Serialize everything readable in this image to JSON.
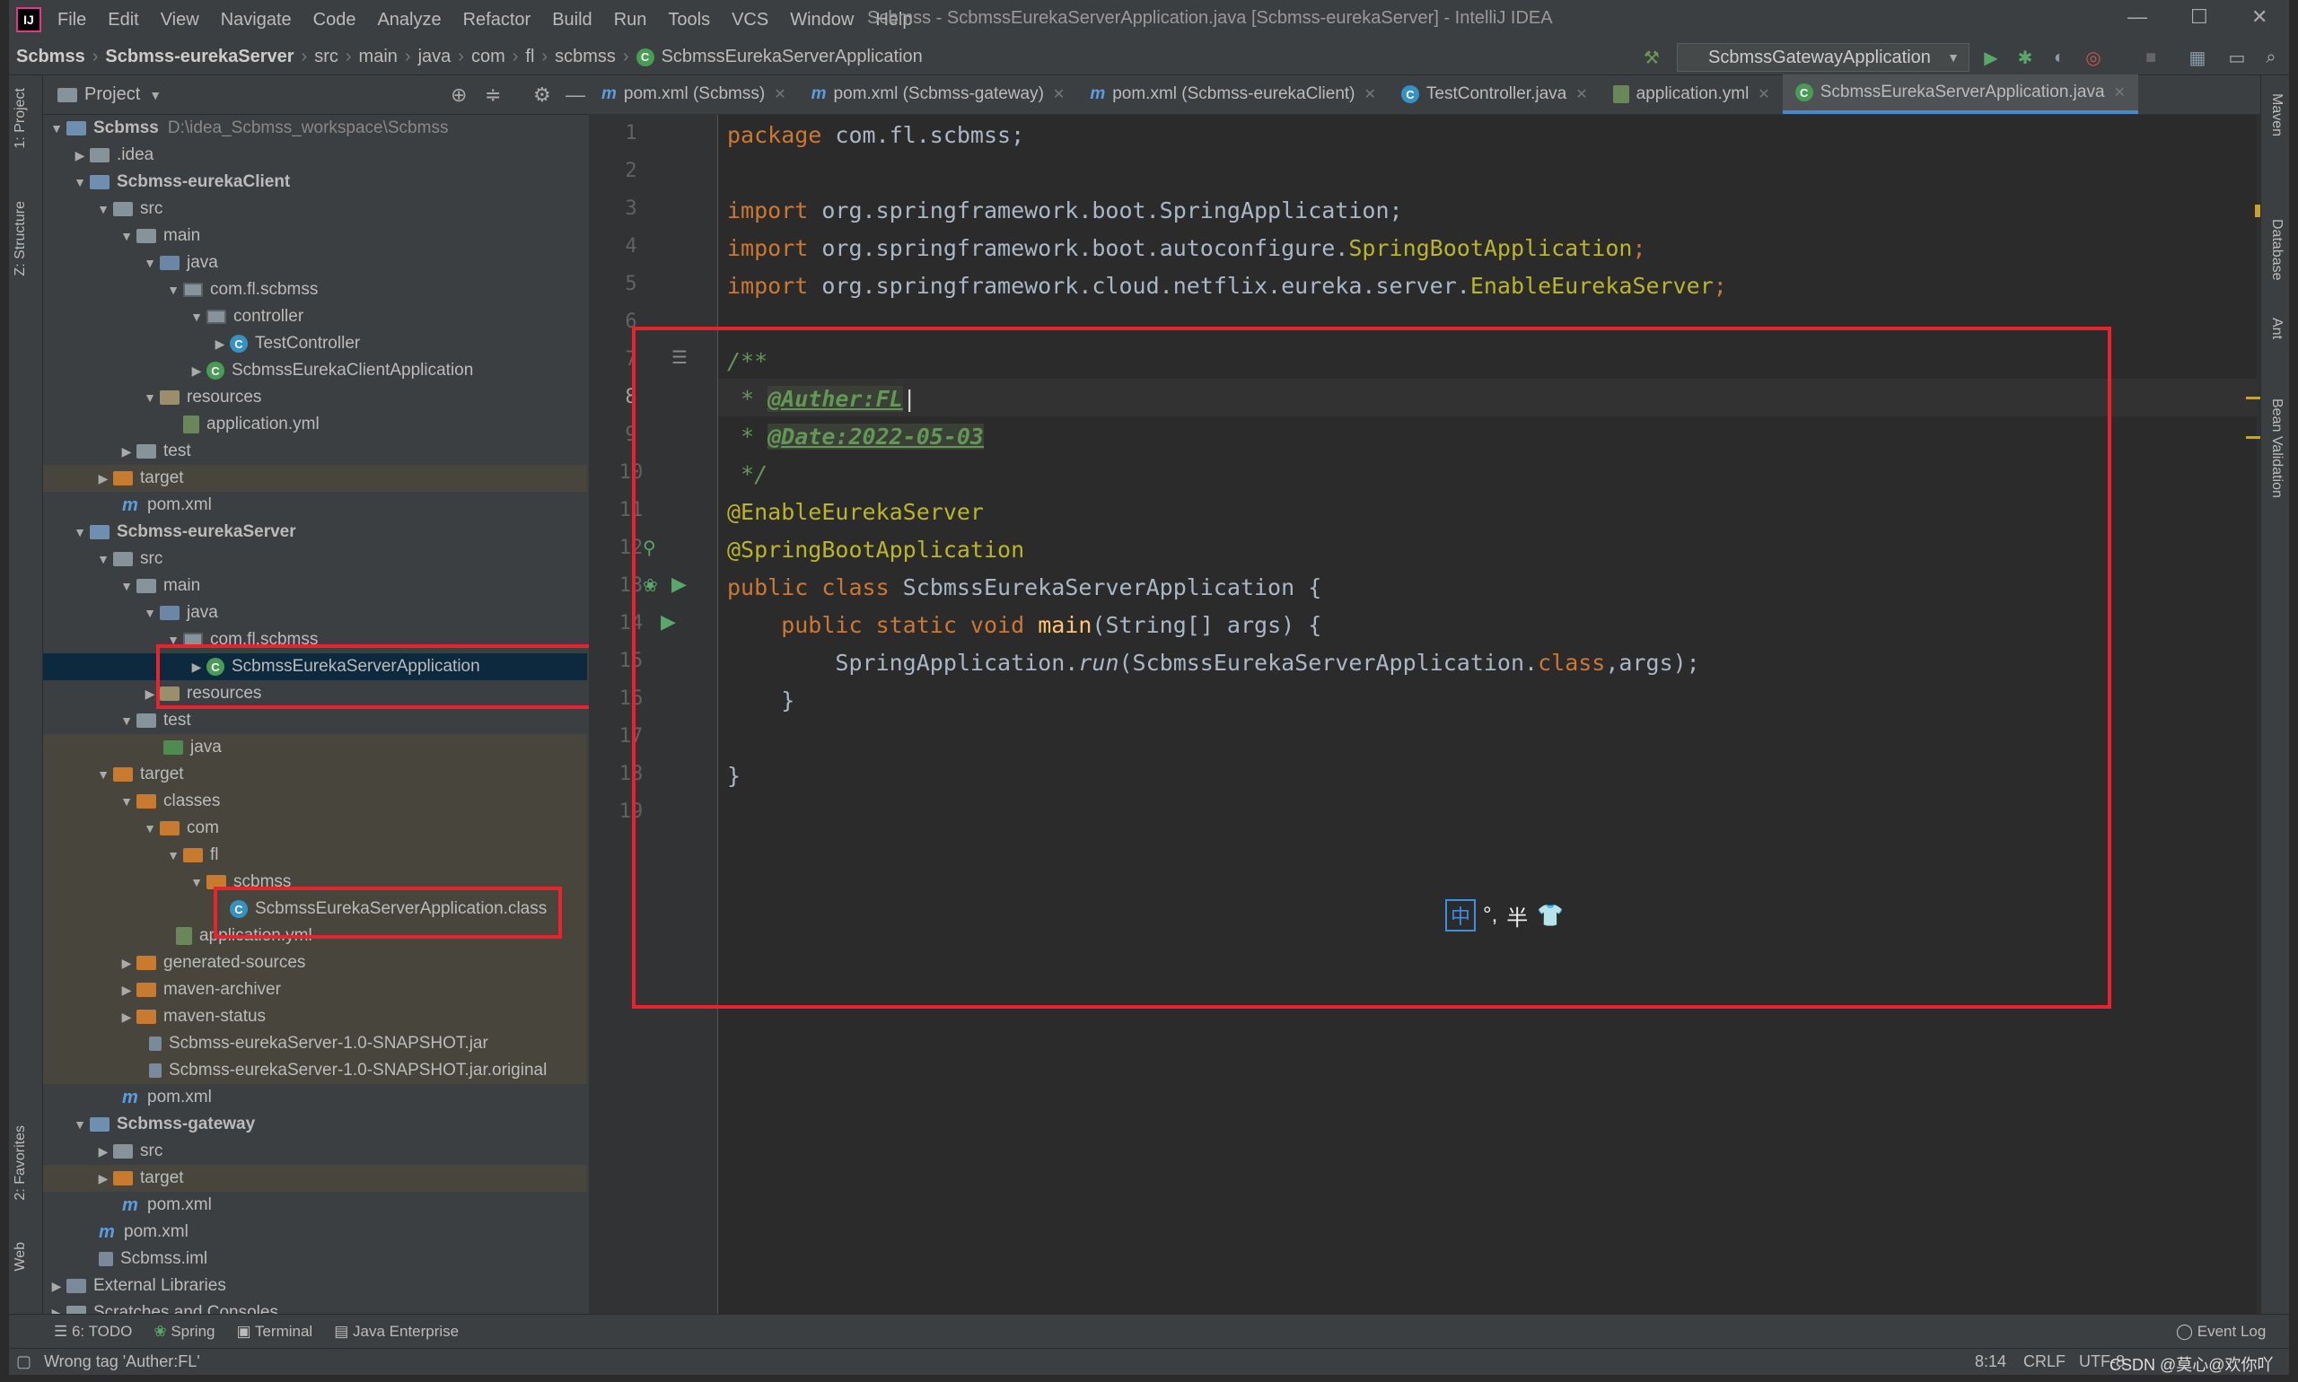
{
  "window_title": "Scbmss - ScbmssEurekaServerApplication.java [Scbmss-eurekaServer] - IntelliJ IDEA",
  "app_logo": "IJ",
  "menu": [
    "File",
    "Edit",
    "View",
    "Navigate",
    "Code",
    "Analyze",
    "Refactor",
    "Build",
    "Run",
    "Tools",
    "VCS",
    "Window",
    "Help"
  ],
  "breadcrumbs": [
    "Scbmss",
    "Scbmss-eurekaServer",
    "src",
    "main",
    "java",
    "com",
    "fl",
    "scbmss",
    "ScbmssEurekaServerApplication"
  ],
  "run_config": "ScbmssGatewayApplication",
  "left_stripe": [
    "1: Project",
    "Z: Structure",
    "2: Favorites",
    "Web"
  ],
  "right_stripe": [
    "Maven",
    "Database",
    "Ant",
    "Bean Validation"
  ],
  "project_panel": {
    "title": "Project",
    "tree": [
      {
        "text": "Scbmss",
        "extra": "D:\\idea_Scbmss_workspace\\Scbmss",
        "bold": true
      },
      {
        "text": ".idea"
      },
      {
        "text": "Scbmss-eurekaClient",
        "bold": true
      },
      {
        "text": "src"
      },
      {
        "text": "main"
      },
      {
        "text": "java"
      },
      {
        "text": "com.fl.scbmss"
      },
      {
        "text": "controller"
      },
      {
        "text": "TestController"
      },
      {
        "text": "ScbmssEurekaClientApplication"
      },
      {
        "text": "resources"
      },
      {
        "text": "application.yml"
      },
      {
        "text": "test"
      },
      {
        "text": "target"
      },
      {
        "text": "pom.xml"
      },
      {
        "text": "Scbmss-eurekaServer",
        "bold": true
      },
      {
        "text": "src"
      },
      {
        "text": "main"
      },
      {
        "text": "java"
      },
      {
        "text": "com.fl.scbmss"
      },
      {
        "text": "ScbmssEurekaServerApplication"
      },
      {
        "text": "resources"
      },
      {
        "text": "test"
      },
      {
        "text": "java"
      },
      {
        "text": "target"
      },
      {
        "text": "classes"
      },
      {
        "text": "com"
      },
      {
        "text": "fl"
      },
      {
        "text": "scbmss"
      },
      {
        "text": "ScbmssEurekaServerApplication.class"
      },
      {
        "text": "application.yml"
      },
      {
        "text": "generated-sources"
      },
      {
        "text": "maven-archiver"
      },
      {
        "text": "maven-status"
      },
      {
        "text": "Scbmss-eurekaServer-1.0-SNAPSHOT.jar"
      },
      {
        "text": "Scbmss-eurekaServer-1.0-SNAPSHOT.jar.original"
      },
      {
        "text": "pom.xml"
      },
      {
        "text": "Scbmss-gateway",
        "bold": true
      },
      {
        "text": "src"
      },
      {
        "text": "target"
      },
      {
        "text": "pom.xml"
      },
      {
        "text": "pom.xml"
      },
      {
        "text": "Scbmss.iml"
      },
      {
        "text": "External Libraries"
      },
      {
        "text": "Scratches and Consoles"
      }
    ]
  },
  "editor_tabs": [
    "pom.xml (Scbmss)",
    "pom.xml (Scbmss-gateway)",
    "pom.xml (Scbmss-eurekaClient)",
    "TestController.java",
    "application.yml",
    "ScbmssEurekaServerApplication.java"
  ],
  "line_numbers": [
    "1",
    "2",
    "3",
    "4",
    "5",
    "6",
    "7",
    "8",
    "9",
    "10",
    "11",
    "12",
    "13",
    "14",
    "15",
    "16",
    "17",
    "18",
    "19"
  ],
  "code": {
    "l1_kw": "package ",
    "l1_rest": "com.fl.scbmss;",
    "l3_kw": "import ",
    "l3_pkg": "org.springframework.boot.SpringApplication;",
    "l4_kw": "import ",
    "l4_pkg": "org.springframework.boot.autoconfigure.",
    "l4_cls": "SpringBootApplication",
    ";": ";",
    "l5_kw": "import ",
    "l5_pkg": "org.springframework.cloud.netflix.eureka.server.",
    "l5_cls": "EnableEurekaServer",
    "l7": "/**",
    "l8_star": " * ",
    "l8_tag": "@Auther:FL",
    "l9_star": " * ",
    "l9_tag": "@Date:2022-05-03",
    "l10": " */",
    "l11": "@EnableEurekaServer",
    "l12": "@SpringBootApplication",
    "l13_kw": "public class ",
    "l13_rest": "ScbmssEurekaServerApplication {",
    "l14_kw": "    public static void ",
    "l14_m": "main",
    "l14_rest": "(String[] args) {",
    "l15_a": "        SpringApplication.",
    "l15_run": "run",
    "l15_b": "(ScbmssEurekaServerApplication.",
    "l15_kw": "class",
    "l15_c": ",args);",
    "l16": "    }",
    "l18": "}"
  },
  "ime": {
    "zh": "中",
    "punct": "°,",
    "half": "半"
  },
  "bottom_tools": [
    "6: TODO",
    "Spring",
    "Terminal",
    "Java Enterprise"
  ],
  "event_log": "Event Log",
  "status": {
    "message": "Wrong tag 'Auther:FL'",
    "position": "8:14",
    "line_sep": "CRLF",
    "encoding": "UTF-8"
  },
  "watermark": "CSDN @莫心@欢你吖"
}
